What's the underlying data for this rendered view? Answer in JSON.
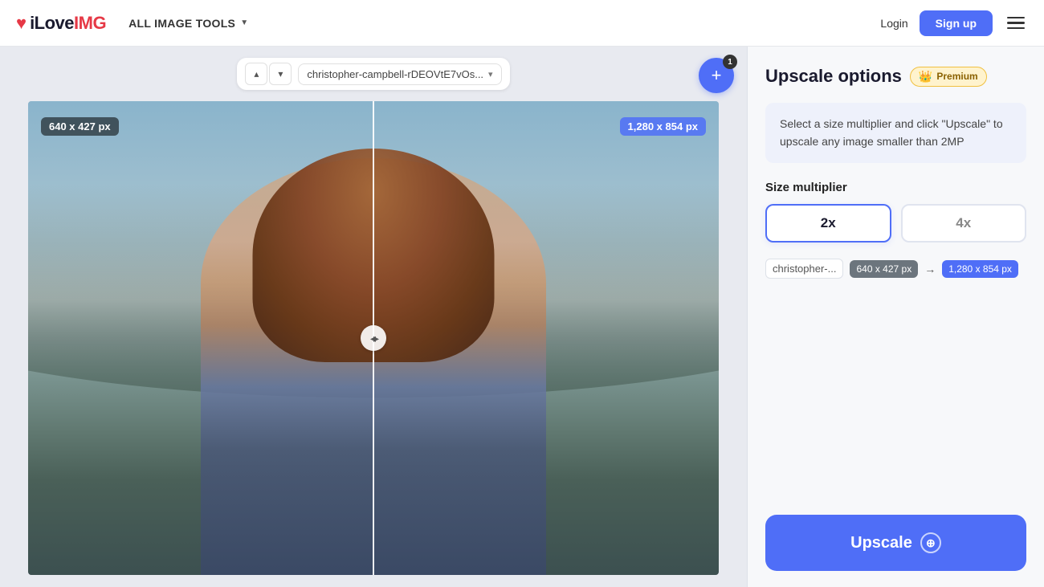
{
  "header": {
    "logo_heart": "♥",
    "logo_text": "iLove",
    "logo_img": "IMG",
    "all_tools_label": "ALL IMAGE TOOLS",
    "chevron": "▼",
    "login_label": "Login",
    "signup_label": "Sign up",
    "hamburger_lines": 3
  },
  "toolbar": {
    "arrow_up": "▲",
    "arrow_down": "▼",
    "file_name": "christopher-campbell-rDEOVtE7vOs...",
    "file_chevron": "▾",
    "add_badge": "1",
    "add_plus": "+"
  },
  "image_compare": {
    "size_left": "640 x 427 px",
    "size_right": "1,280 x 854 px"
  },
  "right_panel": {
    "title": "Upscale options",
    "premium_label": "Premium",
    "premium_crown": "👑",
    "info_text": "Select a size multiplier and click \"Upscale\" to upscale any image smaller than 2MP",
    "section_label": "Size multiplier",
    "btn_2x": "2x",
    "btn_4x": "4x",
    "file_info_name": "christopher-...",
    "file_info_from": "640 x 427 px",
    "file_info_arrow": "→",
    "file_info_to": "1,280 x 854 px",
    "upscale_label": "Upscale",
    "upscale_icon": "⊕"
  }
}
